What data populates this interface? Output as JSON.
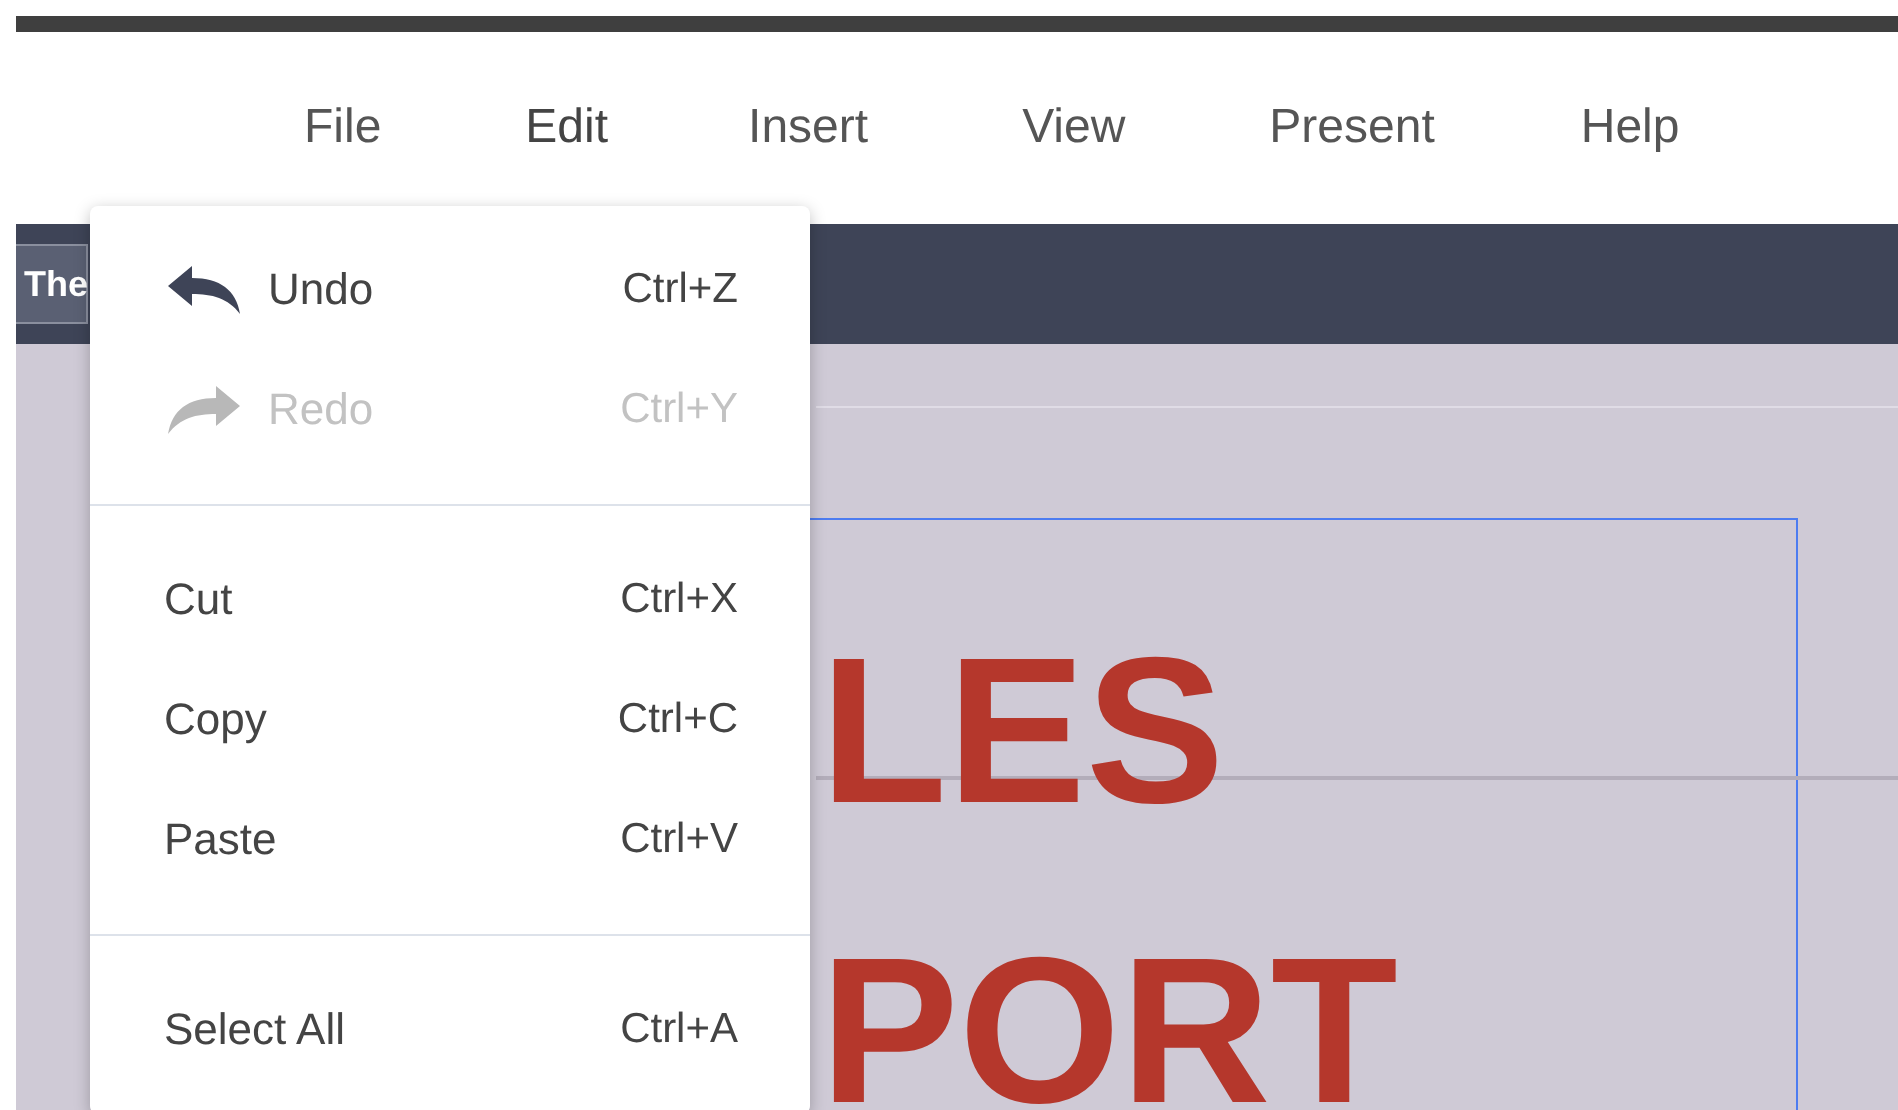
{
  "menubar": [
    {
      "label": "File",
      "selected": false
    },
    {
      "label": "Edit",
      "selected": true
    },
    {
      "label": "Insert",
      "selected": false
    },
    {
      "label": "View",
      "selected": false
    },
    {
      "label": "Present",
      "selected": false
    },
    {
      "label": "Help",
      "selected": false
    }
  ],
  "toolbar": {
    "tab": "The"
  },
  "slide": {
    "lines": [
      "LES",
      "PORT"
    ]
  },
  "edit_menu": {
    "sections": [
      [
        {
          "kind": "undo",
          "label": "Undo",
          "shortcut": "Ctrl+Z",
          "disabled": false
        },
        {
          "kind": "redo",
          "label": "Redo",
          "shortcut": "Ctrl+Y",
          "disabled": true
        }
      ],
      [
        {
          "kind": "plain",
          "label": "Cut",
          "shortcut": "Ctrl+X",
          "disabled": false
        },
        {
          "kind": "plain",
          "label": "Copy",
          "shortcut": "Ctrl+C",
          "disabled": false
        },
        {
          "kind": "plain",
          "label": "Paste",
          "shortcut": "Ctrl+V",
          "disabled": false
        }
      ],
      [
        {
          "kind": "plain",
          "label": "Select All",
          "shortcut": "Ctrl+A",
          "disabled": false
        }
      ]
    ]
  }
}
